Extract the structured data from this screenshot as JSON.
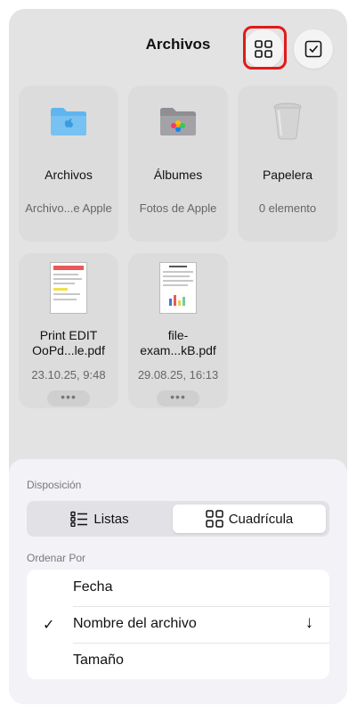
{
  "header": {
    "title": "Archivos"
  },
  "items": [
    {
      "name": "Archivos",
      "sub": "Archivo...e Apple",
      "icon": "folder-icon"
    },
    {
      "name": "Álbumes",
      "sub": "Fotos de Apple",
      "icon": "photos-folder-icon"
    },
    {
      "name": "Papelera",
      "sub": "0 elemento",
      "icon": "trash-icon"
    },
    {
      "name_line1": "Print EDIT",
      "name_line2": "OoPd...le.pdf",
      "sub": "23.10.25, 9:48",
      "more": "•••"
    },
    {
      "name_line1": "file-",
      "name_line2": "exam...kB.pdf",
      "sub": "29.08.25, 16:13",
      "more": "•••"
    }
  ],
  "sheet": {
    "layout_label": "Disposición",
    "options": [
      {
        "label": "Listas"
      },
      {
        "label": "Cuadrícula",
        "selected": true
      }
    ],
    "sort_label": "Ordenar Por",
    "sort_options": [
      {
        "label": "Fecha"
      },
      {
        "label": "Nombre del archivo",
        "checked": true
      },
      {
        "label": "Tamaño"
      }
    ]
  },
  "colors": {
    "highlight": "#e21a1a",
    "folder": "#5fb5ef"
  }
}
